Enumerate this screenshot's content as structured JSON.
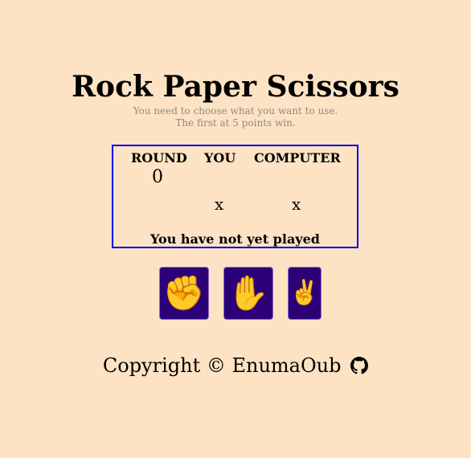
{
  "header": {
    "title": "Rock Paper Scissors",
    "subtitle_line1": "You need to choose what you want to use.",
    "subtitle_line2": "The first at 5 points win."
  },
  "scoreboard": {
    "round_label": "ROUND",
    "you_label": "YOU",
    "computer_label": "COMPUTER",
    "round_value": "0",
    "you_choice": "x",
    "computer_choice": "x",
    "result_message": "You have not yet played"
  },
  "choices": [
    {
      "name": "rock",
      "glyph": "✊",
      "icon": "raised-fist-icon"
    },
    {
      "name": "paper",
      "glyph": "✋",
      "icon": "raised-hand-icon"
    },
    {
      "name": "scissors",
      "glyph": "✌️",
      "icon": "victory-hand-icon"
    }
  ],
  "footer": {
    "copyright": "Copyright © EnumaOub",
    "icon": "github-icon"
  },
  "colors": {
    "background": "#fde3c3",
    "button": "#2c0077",
    "scoreboard_border": "#0000ee",
    "subtitle": "#8f8a85"
  }
}
